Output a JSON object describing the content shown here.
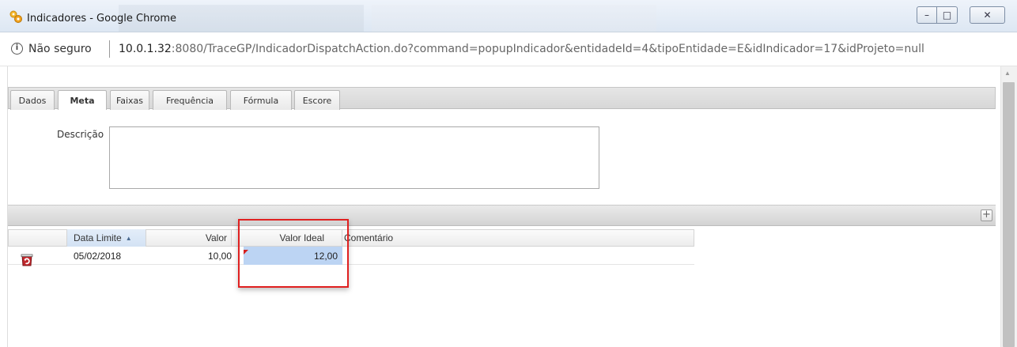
{
  "window": {
    "title": "Indicadores - Google Chrome",
    "minimize_glyph": "–",
    "maximize_glyph": "□",
    "close_glyph": "✕"
  },
  "address_bar": {
    "security_label": "Não seguro",
    "url_host": "10.0.1.32",
    "url_rest": ":8080/TraceGP/IndicadorDispatchAction.do?command=popupIndicador&entidadeId=4&tipoEntidade=E&idIndicador=17&idProjeto=null"
  },
  "tabs": [
    {
      "label": "Dados",
      "active": false
    },
    {
      "label": "Meta",
      "active": true
    },
    {
      "label": "Faixas",
      "active": false
    },
    {
      "label": "Frequência",
      "active": false
    },
    {
      "label": "Fórmula",
      "active": false
    },
    {
      "label": "Escore",
      "active": false
    }
  ],
  "form": {
    "description_label": "Descrição",
    "description_value": ""
  },
  "grid": {
    "add_label": "+",
    "columns": {
      "data_limite": "Data Limite",
      "valor": "Valor",
      "valor_ideal": "Valor Ideal",
      "comentario": "Comentário"
    },
    "sort_indicator": "▲",
    "rows": [
      {
        "data_limite": "05/02/2018",
        "valor": "10,00",
        "valor_ideal": "12,00",
        "comentario": ""
      }
    ]
  },
  "colors": {
    "highlight": "#e02020",
    "selected_cell": "#bcd4f3",
    "delete_icon": "#c0282d"
  }
}
